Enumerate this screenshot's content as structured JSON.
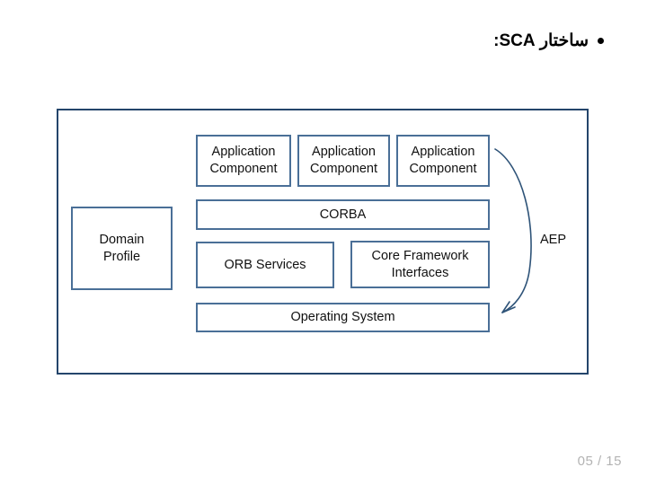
{
  "slide": {
    "heading": "ساختار SCA:",
    "bullet_icon": "bullet-dot-icon",
    "page_number": "05 / 15",
    "accent_colors": {
      "frame_border": "#24456b",
      "box_border": "#4a6f97",
      "arrow": "#2e5378",
      "page_number_text": "#b3b3b3",
      "background": "#ffffff"
    }
  },
  "diagram": {
    "name": "sca-architecture-diagram",
    "boxes": {
      "domain_profile": "Domain\nProfile",
      "application_component_1": "Application\nComponent",
      "application_component_2": "Application\nComponent",
      "application_component_3": "Application\nComponent",
      "corba": "CORBA",
      "orb_services": "ORB Services",
      "core_framework_interfaces": "Core Framework\nInterfaces",
      "operating_system": "Operating System"
    },
    "annotation": {
      "label": "AEP",
      "arrow_icon": "curved-down-arrow-icon"
    }
  }
}
